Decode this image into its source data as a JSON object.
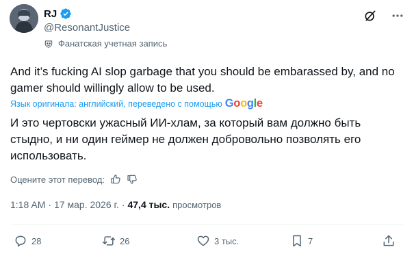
{
  "author": {
    "display_name": "RJ",
    "handle": "@ResonantJustice",
    "account_label": "Фанатская учетная запись"
  },
  "tweet": {
    "original_text": "And it’s fucking AI slop garbage that you should be embarassed by, and no gamer should willingly allow to be used.",
    "translation_note": "Язык оригинала: английский, переведено с помощью",
    "translation_provider": "Google",
    "translated_text": "И это чертовски ужасный ИИ-хлам, за который вам должно быть стыдно, и ни один геймер не должен добровольно позволять его использовать."
  },
  "rate_translation_label": "Оцените этот перевод:",
  "meta": {
    "time": "1:18 AM",
    "separator": "·",
    "date": "17 мар. 2026 г.",
    "views_count": "47,4 тыс.",
    "views_label": "просмотров"
  },
  "actions": {
    "replies": "28",
    "reposts": "26",
    "likes": "3 тыс.",
    "bookmarks": "7"
  },
  "colors": {
    "text": "#0f1419",
    "secondary": "#536471",
    "accent": "#1d9bf0"
  },
  "icons": [
    "grok-icon",
    "more-icon",
    "fan-account-icon",
    "thumbs-up-icon",
    "thumbs-down-icon",
    "reply-icon",
    "repost-icon",
    "like-icon",
    "bookmark-icon",
    "share-icon",
    "verified-badge-icon"
  ]
}
